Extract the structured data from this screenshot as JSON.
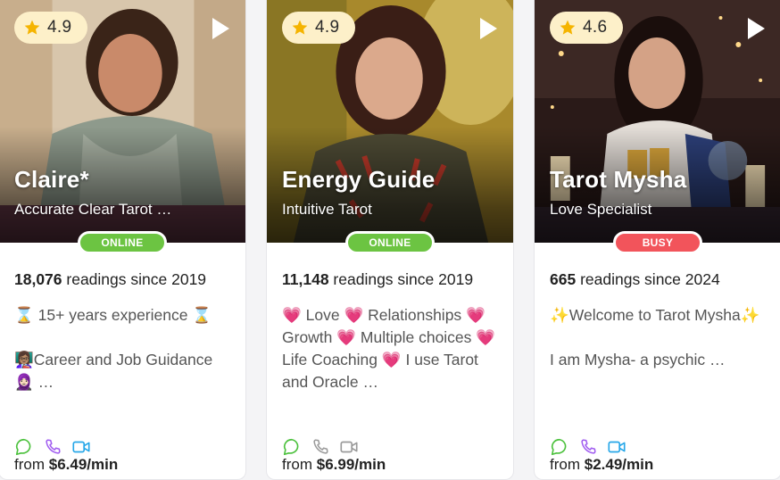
{
  "cards": [
    {
      "rating": "4.9",
      "name": "Claire*",
      "subtitle": "Accurate Clear Tarot …",
      "status": "ONLINE",
      "readings_count": "18,076",
      "readings_text": " readings since 2019",
      "description": "⌛ 15+ years experience ⌛\n\n👩🏽‍🏫Career and Job Guidance 🧕🏻 …",
      "price_prefix": "from ",
      "price": "$6.49/min",
      "photo_colors": [
        "#cdb79a",
        "#8c8a7c"
      ]
    },
    {
      "rating": "4.9",
      "name": "Energy Guide",
      "subtitle": "Intuitive Tarot",
      "status": "ONLINE",
      "readings_count": "11,148",
      "readings_text": " readings since 2019",
      "description": "💗 Love 💗 Relationships 💗 Growth 💗 Multiple choices 💗 Life Coaching 💗 I use Tarot and Oracle …",
      "price_prefix": "from ",
      "price": "$6.99/min",
      "photo_colors": [
        "#b7962c",
        "#6b5a25"
      ]
    },
    {
      "rating": "4.6",
      "name": "Tarot Mysha",
      "subtitle": "Love Specialist",
      "status": "BUSY",
      "readings_count": "665",
      "readings_text": " readings since 2024",
      "description": "✨Welcome to Tarot Mysha✨\n\nI am Mysha- a psychic …",
      "price_prefix": "from ",
      "price": "$2.49/min",
      "photo_colors": [
        "#3b2420",
        "#1c1211"
      ]
    }
  ],
  "colors": {
    "online": "#6cc442",
    "busy": "#f2545b",
    "rating_bg": "#fdf0c9",
    "star": "#f5b400",
    "chat_icon": "#4cc13d",
    "call_icon_active": "#a05cf0",
    "call_icon_inactive": "#9a9a9a",
    "video_icon_active": "#27a7e8",
    "video_icon_inactive": "#9a9a9a"
  }
}
